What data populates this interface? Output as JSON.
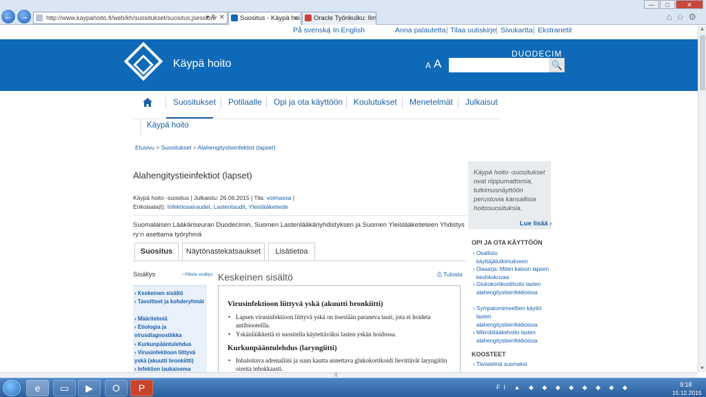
{
  "browser": {
    "url": "http://www.kaypahoito.fi/web/kh/suositukset/suositus;jsessioni",
    "tabs": [
      {
        "label": "Suositus - Käypä hoi...",
        "close": "×"
      },
      {
        "label": "Oracle Työnkulku: Ilmoi...",
        "close": ""
      }
    ],
    "back": "←",
    "forward": "→",
    "window_controls": {
      "minimize": "—",
      "maximize": "□",
      "close": "✕"
    }
  },
  "utility_bar": {
    "lang_sv": "På svenska",
    "lang_en": "In English",
    "feedback": "Anna palautetta",
    "newsletter": "Tilaa uutiskirje",
    "sitemap": "Sivukartta",
    "extranets": "Ekstranetit",
    "divider": "|"
  },
  "banner": {
    "logo_text": "Käypä hoito",
    "brand": "DUODECIM",
    "font_small": "A",
    "font_large": "A",
    "search_placeholder": "",
    "search_icon": "🔍"
  },
  "nav": {
    "home_icon": "home-icon",
    "items": [
      "Suositukset",
      "Potilaalle",
      "Opi ja ota käyttöön",
      "Koulutukset",
      "Menetelmät",
      "Julkaisut"
    ],
    "sub_item": "Käypä hoito"
  },
  "breadcrumb": {
    "home": "Etusivu",
    "sep": ">",
    "level1": "Suositukset",
    "current": "Alahengitystieinfektiot (lapset)"
  },
  "article": {
    "title": "Alahengitystieinfektiot (lapset)",
    "meta_type": "Käypä hoito -suositus",
    "meta_published_label": "Julkaistu:",
    "meta_published": "26.06.2015",
    "meta_status_label": "Tila:",
    "meta_status": "voimassa",
    "specialty_label": "Erikoisala(t):",
    "specialties": [
      "Infektiosairaudet",
      "Lastentaudit",
      "Yleislääketiede"
    ],
    "description": "Suomalaisen Lääkäriseuran Duodecimin, Suomen Lastenlääkäriyhdistyksen ja Suomen Yleislääketieteen Yhdistys ry:n asettama työryhmä"
  },
  "content_tabs": [
    "Suositus",
    "Näytönastekatsaukset",
    "Lisätietoa"
  ],
  "toc": {
    "title": "Sisällys",
    "hide": "Piilota sisällys",
    "items": [
      "Keskeinen sisältö",
      "Tavoitteet ja kohderyhmät",
      "Määritelmiä",
      "Etiologia ja virusdiagnostiikka",
      "Kurkunpääntulehdus",
      "Virusinfektioon liittyvä yskä (akuutti bronkiitti)",
      "Infektion laukaisema"
    ]
  },
  "content": {
    "heading": "Keskeinen sisältö",
    "print": "Tulosta",
    "section1_title": "Virusinfektioon liittyvä yskä (akuutti bronkiitti)",
    "section1_bullets": [
      "Lapsen virusinfektioon liittyvä yskä on itsestään paraneva tauti, jota ei hoideta antibiooteilla.",
      "Yskänlääkkeitä ei suositella käytettäväksi lasten yskän hoidossa."
    ],
    "section2_title": "Kurkunpääntulehdus (laryngiitti)",
    "section2_bullets": [
      "Inhaloitava adrenaliini ja suun kautta annettava glukokortikoidi lievittävät laryngiitin oireita tehokkaasti."
    ]
  },
  "sidebar": {
    "info_text": "Käypä hoito -suositukset ovat riippumattomia, tutkimusnäyttöön perustuvia kansallisia hoitosuosituksia.",
    "info_more": "Lue lisää ›",
    "section1_title": "OPI JA OTA KÄYTTÖÖN",
    "section1_items": [
      "Osallistu käyttäjätutkimukseen",
      "Diasarja: Miten katson lapsen keuhkokuvaa",
      "Glukokortikoidihoito lasten alahengitystieinfektioissa",
      "Sympatomimeettien käyttö lasten alahengitystieinfektioissa",
      "Mikrobilääkehoito lasten alahengitystieinfektioissa"
    ],
    "section2_title": "KOOSTEET",
    "section2_items": [
      "Tiivistelmä suomeksi"
    ]
  },
  "taskbar": {
    "apps": [
      "internet-explorer",
      "file-explorer",
      "media-player",
      "outlook",
      "powerpoint"
    ],
    "lang": "FI",
    "time": "9:18",
    "date": "15.12.2015"
  },
  "colors": {
    "brand_blue": "#0e6ab8",
    "link": "#1a5fa8"
  }
}
